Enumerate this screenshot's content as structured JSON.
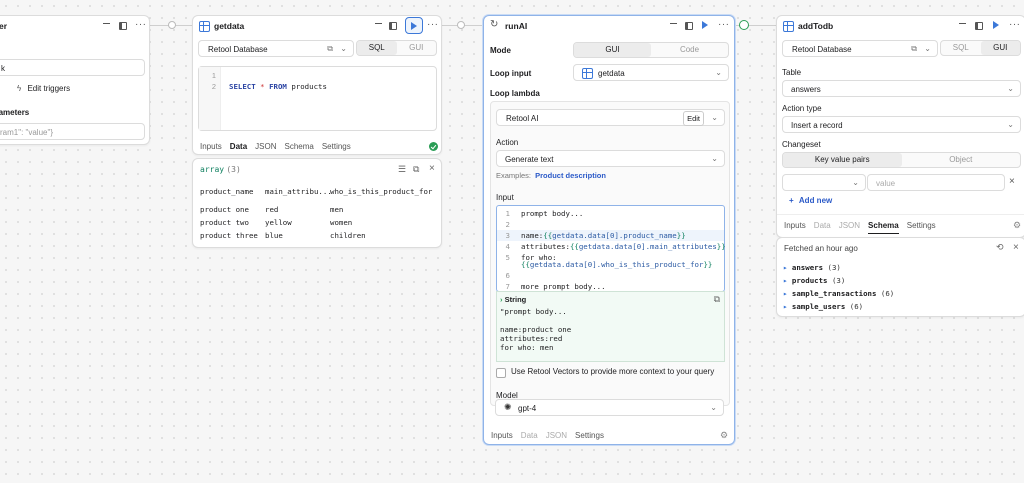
{
  "triggerPanel": {
    "header": "er",
    "field1": "k",
    "editTriggersLabel": "Edit triggers",
    "parametersLabel": "arameters",
    "paramPlaceholder": "ram1\": \"value\"}"
  },
  "getdata": {
    "title": "getdata",
    "resource": "Retool Database",
    "modeSql": "SQL",
    "modeGui": "GUI",
    "lineNumbers": [
      "1",
      "2"
    ],
    "query": {
      "select": "SELECT",
      "star": "*",
      "from": "FROM",
      "table": "products"
    },
    "tabs": [
      "Inputs",
      "Data",
      "JSON",
      "Schema",
      "Settings"
    ],
    "activeTab": "Data"
  },
  "dataPreview": {
    "type": "array",
    "count": "(3)",
    "columns": [
      "product_name",
      "main_attribu...",
      "who_is_this_product_for"
    ],
    "rows": [
      [
        "product one",
        "red",
        "men"
      ],
      [
        "product two",
        "yellow",
        "women"
      ],
      [
        "product three",
        "blue",
        "children"
      ]
    ]
  },
  "runAI": {
    "title": "runAI",
    "modeLabel": "Mode",
    "modeGui": "GUI",
    "modeCode": "Code",
    "loopInputLabel": "Loop input",
    "loopInputValue": "getdata",
    "loopLambdaLabel": "Loop lambda",
    "resource": "Retool AI",
    "editLabel": "Edit",
    "actionLabel": "Action",
    "actionValue": "Generate text",
    "examplesLabel": "Examples:",
    "examplesLink": "Product description",
    "inputLabel": "Input",
    "inputLineNumbers": [
      "1",
      "2",
      "3",
      "4",
      "5",
      "",
      "6",
      "7"
    ],
    "inputCode": {
      "l1": "prompt body...",
      "l3a": "name:",
      "l3b": "{{",
      "l3c": "getdata.data[0].product_name",
      "l3d": "}}",
      "l4a": "attributes:",
      "l4b": "{{",
      "l4c": "getdata.data[0].main_attributes",
      "l4d": "}}",
      "l5a": "for who:",
      "l5b": "{{",
      "l5c": "getdata.data[0].who_is_this_product_for",
      "l5d": "}}",
      "l7": "more prompt body..."
    },
    "previewType": "String",
    "previewLines": [
      "\"prompt body...",
      "",
      "name:product one",
      "attributes:red",
      "for who: men"
    ],
    "vectorsLabel": "Use Retool Vectors to provide more context to your query",
    "modelLabel": "Model",
    "modelValue": "gpt-4",
    "tabs": [
      "Inputs",
      "Data",
      "JSON",
      "Settings"
    ],
    "activeTab": "Inputs"
  },
  "addTodb": {
    "title": "addTodb",
    "resource": "Retool Database",
    "modeSql": "SQL",
    "modeGui": "GUI",
    "tableLabel": "Table",
    "tableValue": "answers",
    "actionTypeLabel": "Action type",
    "actionTypeValue": "Insert a record",
    "changesetLabel": "Changeset",
    "changesetKV": "Key value pairs",
    "changesetObj": "Object",
    "valuePlaceholder": "value",
    "addNewLabel": "Add new",
    "tabs": [
      "Inputs",
      "Data",
      "JSON",
      "Schema",
      "Settings"
    ],
    "activeTab": "Schema"
  },
  "schemaPanel": {
    "fetched": "Fetched an hour ago",
    "tables": [
      {
        "name": "answers",
        "count": "(3)"
      },
      {
        "name": "products",
        "count": "(3)"
      },
      {
        "name": "sample_transactions",
        "count": "(6)"
      },
      {
        "name": "sample_users",
        "count": "(6)"
      }
    ]
  },
  "colors": {
    "accent": "#3c78d8",
    "success": "#2a9d55",
    "border": "#dcdcdc"
  }
}
